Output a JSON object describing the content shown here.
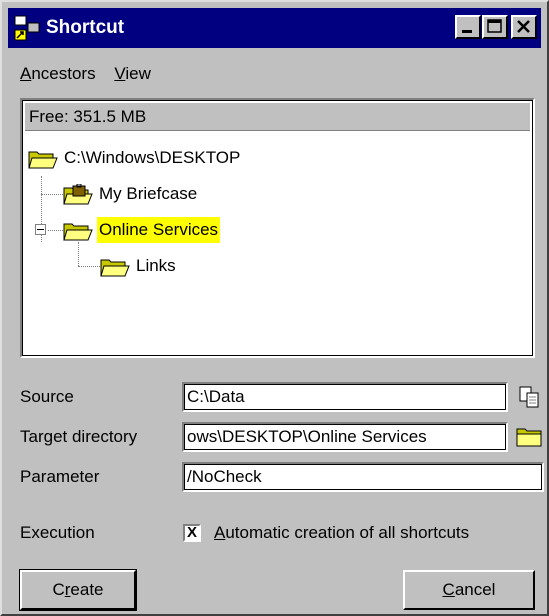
{
  "window": {
    "title": "Shortcut",
    "menu": [
      {
        "key": "A",
        "rest": "ncestors"
      },
      {
        "key": "V",
        "rest": "iew"
      }
    ]
  },
  "tree": {
    "free_space": "Free: 351.5 MB",
    "nodes": [
      {
        "label": "C:\\Windows\\DESKTOP",
        "icon": "open-folder-icon",
        "selected": false
      },
      {
        "label": "My Briefcase",
        "icon": "briefcase-icon",
        "selected": false
      },
      {
        "label": "Online Services",
        "icon": "open-folder-icon",
        "selected": true
      },
      {
        "label": "Links",
        "icon": "open-folder-icon",
        "selected": false
      }
    ],
    "highlight_color": "#ffff00"
  },
  "form": {
    "source_label": "Source",
    "source_value": "C:\\Data",
    "target_label": "Target directory",
    "target_value": "ows\\DESKTOP\\Online Services",
    "parameter_label": "Parameter",
    "parameter_value": "/NoCheck",
    "execution_label": "Execution",
    "checkbox_checked": true,
    "checkbox_mark": "X",
    "checkbox_key": "A",
    "checkbox_rest": "utomatic creation of all shortcuts"
  },
  "buttons": {
    "create_pre": "C",
    "create_key": "r",
    "create_post": "eate",
    "cancel_key": "C",
    "cancel_rest": "ancel"
  },
  "colors": {
    "titlebar": "#000080",
    "face": "#c0c0c0"
  }
}
